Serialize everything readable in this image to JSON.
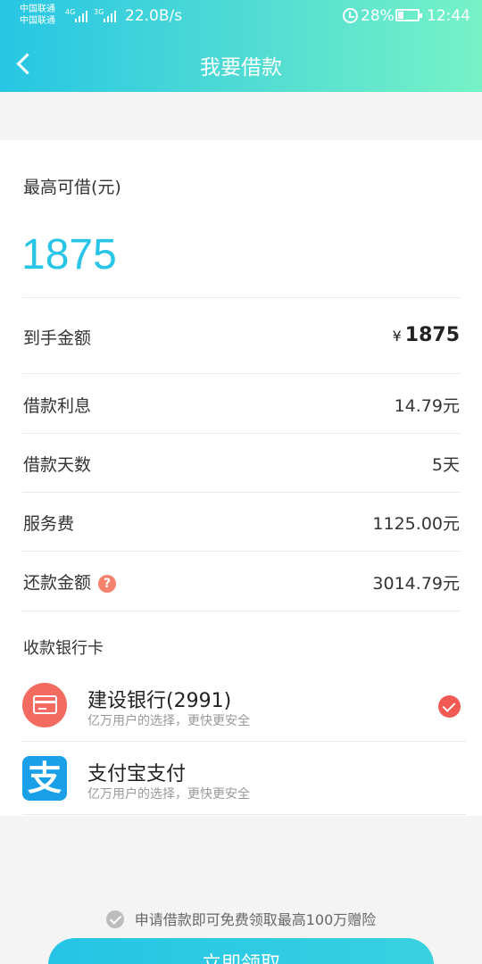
{
  "status_bar": {
    "carrier1": "中国联通",
    "carrier2": "中国联通",
    "net1": "4G",
    "net2": "3G",
    "speed": "22.0B/s",
    "battery_percent": "28%",
    "battery_level": 0.28,
    "time": "12:44"
  },
  "header": {
    "title": "我要借款"
  },
  "loan": {
    "max_label": "最高可借(元)",
    "max_value": "1875",
    "rows": [
      {
        "label": "到手金额",
        "value": "1875",
        "currency": "¥"
      },
      {
        "label": "借款利息",
        "value": "14.79元"
      },
      {
        "label": "借款天数",
        "value": "5天"
      },
      {
        "label": "服务费",
        "value": "1125.00元"
      },
      {
        "label": "还款金额",
        "value": "3014.79元",
        "help": "?"
      }
    ]
  },
  "bank_section": {
    "label": "收款银行卡",
    "items": [
      {
        "name": "建设银行(2991)",
        "subtitle": "亿万用户的选择，更快更安全",
        "selected": true
      },
      {
        "name": "支付宝支付",
        "subtitle": "亿万用户的选择，更快更安全",
        "icon_char": "支",
        "selected": false
      }
    ]
  },
  "footer": {
    "agreement": "申请借款即可免费领取最高100万赠险",
    "submit_label": "立即领取"
  }
}
